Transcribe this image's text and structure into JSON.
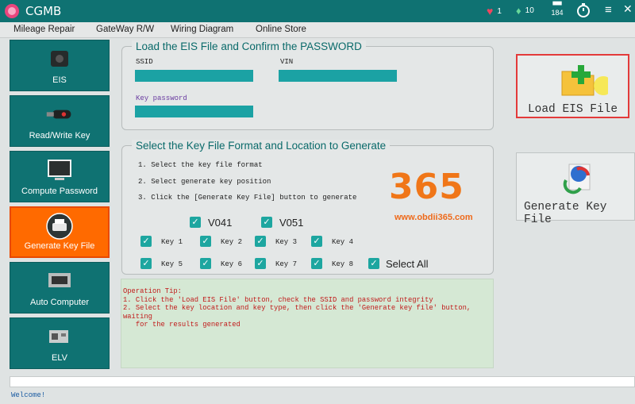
{
  "app": {
    "title": "CGMB"
  },
  "titlebar": {
    "heart_count": "1",
    "diamond_count": "10",
    "counter": "184"
  },
  "menu": [
    "Mileage Repair",
    "GateWay R/W",
    "Wiring Diagram",
    "Online Store"
  ],
  "sidebar": {
    "items": [
      {
        "label": "EIS"
      },
      {
        "label": "Read/Write Key"
      },
      {
        "label": "Compute Password"
      },
      {
        "label": "Generate Key File"
      },
      {
        "label": "Auto Computer"
      },
      {
        "label": "ELV"
      }
    ]
  },
  "load_panel": {
    "title": "Load the EIS File and Confirm the PASSWORD",
    "ssid_label": "SSID",
    "vin_label": "VIN",
    "key_password_label": "Key password"
  },
  "key_panel": {
    "title": "Select the Key File Format and Location to Generate",
    "steps": [
      "1. Select the key file format",
      "2. Select generate key position",
      "3. Click the [Generate Key File] button to generate"
    ],
    "formats": [
      "V041",
      "V051"
    ],
    "keys": [
      "Key 1",
      "Key 2",
      "Key 3",
      "Key 4",
      "Key 5",
      "Key 6",
      "Key 7",
      "Key 8"
    ],
    "select_all": "Select All"
  },
  "tips": {
    "header": "Operation Tip:",
    "lines": [
      "1. Click the 'Load EIS File' button, check the SSID and password integrity",
      "2. Select the key location and key type, then click the 'Generate key file' button, waiting",
      "   for the results generated"
    ]
  },
  "buttons": {
    "load": "Load EIS File",
    "generate": "Generate Key File"
  },
  "watermark": {
    "number": "365",
    "url": "www.obdii365.com"
  },
  "status": {
    "message": "Welcome!"
  },
  "colors": {
    "teal": "#0f7272",
    "active": "#ff6a00",
    "field": "#1ba2a4",
    "tip_text": "#c11b1b"
  }
}
